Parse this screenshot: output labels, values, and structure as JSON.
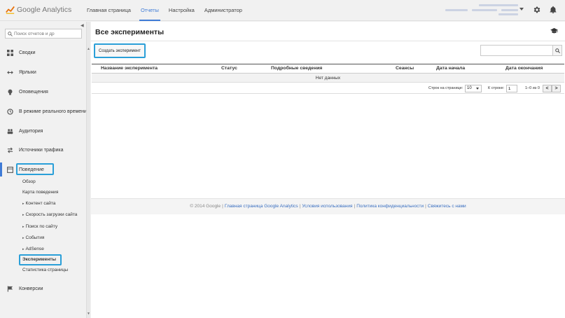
{
  "app": {
    "logo_text": "Google Analytics"
  },
  "topnav": {
    "items": [
      {
        "label": "Главная страница"
      },
      {
        "label": "Отчеты"
      },
      {
        "label": "Настройка"
      },
      {
        "label": "Администратор"
      }
    ],
    "active_index": 1
  },
  "sidebar": {
    "search_placeholder": "Поиск отчетов и др",
    "items": [
      {
        "label": "Сводки",
        "icon": "grid-icon"
      },
      {
        "label": "Ярлыки",
        "icon": "shortcut-arrows-icon"
      },
      {
        "label": "Оповещения",
        "icon": "lightbulb-icon"
      },
      {
        "label": "В режиме реального времени",
        "icon": "clock-icon"
      },
      {
        "label": "Аудитория",
        "icon": "people-icon"
      },
      {
        "label": "Источники трафика",
        "icon": "traffic-arrows-icon"
      },
      {
        "label": "Поведение",
        "icon": "behavior-window-icon"
      },
      {
        "label": "Конверсии",
        "icon": "flag-icon"
      }
    ],
    "behavior_subitems": [
      {
        "label": "Обзор"
      },
      {
        "label": "Карта поведения"
      },
      {
        "label": "Контент сайта"
      },
      {
        "label": "Скорость загрузки сайта"
      },
      {
        "label": "Поиск по сайту"
      },
      {
        "label": "События"
      },
      {
        "label": "AdSense"
      },
      {
        "label": "Эксперименты"
      },
      {
        "label": "Статистика страницы"
      }
    ]
  },
  "main": {
    "title": "Все эксперименты",
    "create_button": "Создать эксперимент",
    "columns": [
      "Название эксперимента",
      "Статус",
      "Подробные сведения",
      "Сеансы",
      "Дата начала",
      "Дата окончания"
    ],
    "empty_text": "Нет данных",
    "pager": {
      "rows_label": "Строк на странице:",
      "rows_value": "10",
      "goto_label": "К строке:",
      "goto_value": "1",
      "range": "1–0 из 0",
      "prev": "<",
      "next": ">"
    }
  },
  "footer": {
    "copyright": "© 2014 Google",
    "links": [
      "Главная страница Google Analytics",
      "Условия использования",
      "Политика конфиденциальности",
      "Свяжитесь с нами"
    ]
  },
  "colors": {
    "accent": "#3f7bd6",
    "highlight": "#2a9fd8",
    "link": "#3a6fc0"
  }
}
